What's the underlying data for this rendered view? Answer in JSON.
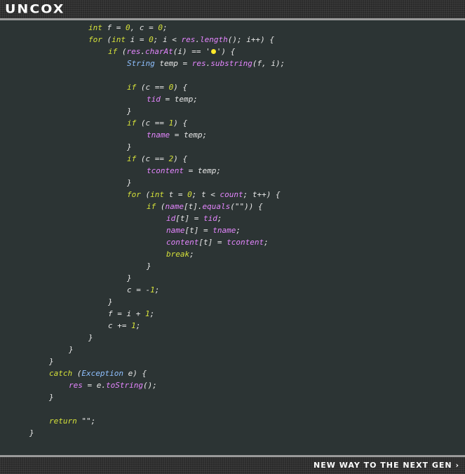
{
  "header": {
    "logo": "UNCOX"
  },
  "footer": {
    "tagline": "NEW WAY TO THE NEXT GEN ›"
  },
  "code": {
    "lines": [
      [
        {
          "t": "int",
          "c": "kw"
        },
        {
          "t": " f = "
        },
        {
          "t": "0",
          "c": "num"
        },
        {
          "t": ", c = "
        },
        {
          "t": "0",
          "c": "num"
        },
        {
          "t": ";"
        }
      ],
      [
        {
          "t": "for",
          "c": "kw"
        },
        {
          "t": " ("
        },
        {
          "t": "int",
          "c": "kw"
        },
        {
          "t": " i = "
        },
        {
          "t": "0",
          "c": "num"
        },
        {
          "t": "; i < "
        },
        {
          "t": "res",
          "c": "pur"
        },
        {
          "t": "."
        },
        {
          "t": "length",
          "c": "pur"
        },
        {
          "t": "(); i++) {"
        }
      ],
      [
        {
          "t": "if",
          "c": "kw"
        },
        {
          "t": " ("
        },
        {
          "t": "res",
          "c": "pur"
        },
        {
          "t": "."
        },
        {
          "t": "charAt",
          "c": "pur"
        },
        {
          "t": "(i) == '"
        },
        {
          "dot": true
        },
        {
          "t": "') {"
        }
      ],
      [
        {
          "t": "String",
          "c": "ty"
        },
        {
          "t": " temp = "
        },
        {
          "t": "res",
          "c": "pur"
        },
        {
          "t": "."
        },
        {
          "t": "substring",
          "c": "pur"
        },
        {
          "t": "(f, i);"
        }
      ],
      [],
      [
        {
          "t": "if",
          "c": "kw"
        },
        {
          "t": " (c == "
        },
        {
          "t": "0",
          "c": "num"
        },
        {
          "t": ") {"
        }
      ],
      [
        {
          "t": "tid",
          "c": "pur"
        },
        {
          "t": " = temp;"
        }
      ],
      [
        {
          "t": "}"
        }
      ],
      [
        {
          "t": "if",
          "c": "kw"
        },
        {
          "t": " (c == "
        },
        {
          "t": "1",
          "c": "num"
        },
        {
          "t": ") {"
        }
      ],
      [
        {
          "t": "tname",
          "c": "pur"
        },
        {
          "t": " = temp;"
        }
      ],
      [
        {
          "t": "}"
        }
      ],
      [
        {
          "t": "if",
          "c": "kw"
        },
        {
          "t": " (c == "
        },
        {
          "t": "2",
          "c": "num"
        },
        {
          "t": ") {"
        }
      ],
      [
        {
          "t": "tcontent",
          "c": "pur"
        },
        {
          "t": " = temp;"
        }
      ],
      [
        {
          "t": "}"
        }
      ],
      [
        {
          "t": "for",
          "c": "kw"
        },
        {
          "t": " ("
        },
        {
          "t": "int",
          "c": "kw"
        },
        {
          "t": " t = "
        },
        {
          "t": "0",
          "c": "num"
        },
        {
          "t": "; t < "
        },
        {
          "t": "count",
          "c": "pur"
        },
        {
          "t": "; t++) {"
        }
      ],
      [
        {
          "t": "if",
          "c": "kw"
        },
        {
          "t": " ("
        },
        {
          "t": "name",
          "c": "pur"
        },
        {
          "t": "[t]."
        },
        {
          "t": "equals",
          "c": "pur"
        },
        {
          "t": "(\"\")) {"
        }
      ],
      [
        {
          "t": "id",
          "c": "pur"
        },
        {
          "t": "[t] = "
        },
        {
          "t": "tid",
          "c": "pur"
        },
        {
          "t": ";"
        }
      ],
      [
        {
          "t": "name",
          "c": "pur"
        },
        {
          "t": "[t] = "
        },
        {
          "t": "tname",
          "c": "pur"
        },
        {
          "t": ";"
        }
      ],
      [
        {
          "t": "content",
          "c": "pur"
        },
        {
          "t": "[t] = "
        },
        {
          "t": "tcontent",
          "c": "pur"
        },
        {
          "t": ";"
        }
      ],
      [
        {
          "t": "break",
          "c": "kw"
        },
        {
          "t": ";"
        }
      ],
      [
        {
          "t": "}"
        }
      ],
      [
        {
          "t": "}"
        }
      ],
      [
        {
          "t": "c = -"
        },
        {
          "t": "1",
          "c": "num"
        },
        {
          "t": ";"
        }
      ],
      [
        {
          "t": "}"
        }
      ],
      [
        {
          "t": "f = i + "
        },
        {
          "t": "1",
          "c": "num"
        },
        {
          "t": ";"
        }
      ],
      [
        {
          "t": "c += "
        },
        {
          "t": "1",
          "c": "num"
        },
        {
          "t": ";"
        }
      ],
      [
        {
          "t": "}"
        }
      ],
      [
        {
          "t": "}"
        }
      ],
      [
        {
          "t": "}"
        }
      ],
      [
        {
          "t": "catch",
          "c": "kw"
        },
        {
          "t": " ("
        },
        {
          "t": "Exception",
          "c": "ty"
        },
        {
          "t": " e) {"
        }
      ],
      [
        {
          "t": "res",
          "c": "pur"
        },
        {
          "t": " = e."
        },
        {
          "t": "toString",
          "c": "pur"
        },
        {
          "t": "();"
        }
      ],
      [
        {
          "t": "}"
        }
      ],
      [],
      [
        {
          "t": "return",
          "c": "kw"
        },
        {
          "t": " \"\";"
        }
      ],
      [
        {
          "t": "}"
        }
      ]
    ]
  }
}
